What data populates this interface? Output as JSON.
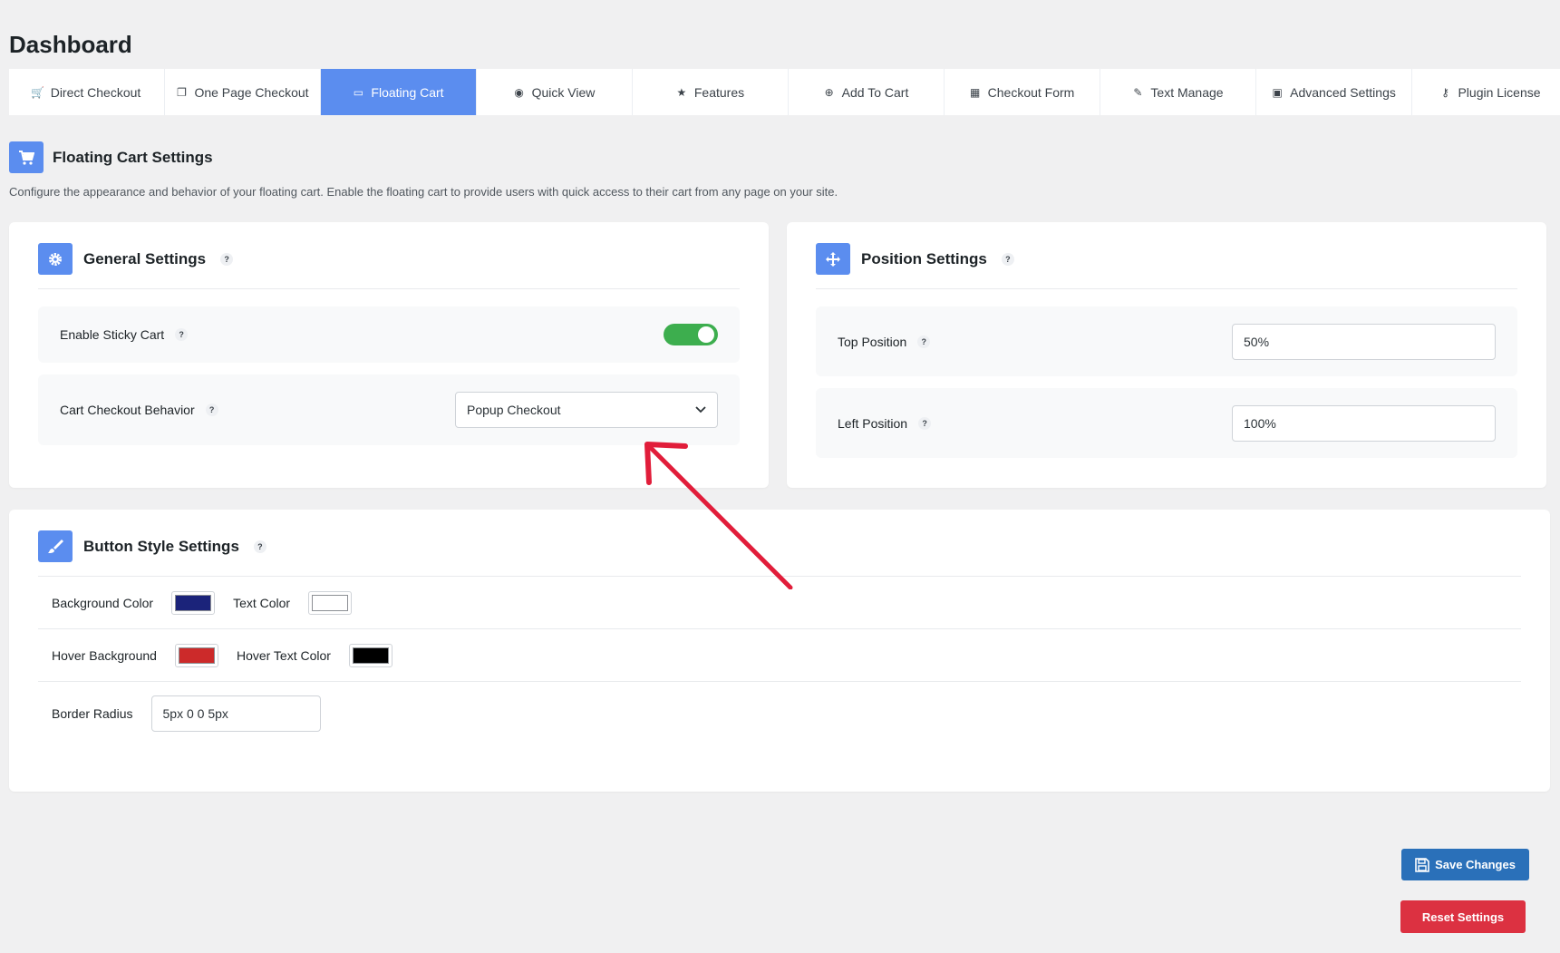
{
  "page_title": "Dashboard",
  "tabs": [
    {
      "label": "Direct Checkout",
      "icon": "cart-icon",
      "glyph": "🛒"
    },
    {
      "label": "One Page Checkout",
      "icon": "copy-icon",
      "glyph": "❐"
    },
    {
      "label": "Floating Cart",
      "icon": "window-icon",
      "glyph": "▭",
      "active": true
    },
    {
      "label": "Quick View",
      "icon": "eye-icon",
      "glyph": "◉"
    },
    {
      "label": "Features",
      "icon": "star-icon",
      "glyph": "★"
    },
    {
      "label": "Add To Cart",
      "icon": "plus-circle-icon",
      "glyph": "⊕"
    },
    {
      "label": "Checkout Form",
      "icon": "form-icon",
      "glyph": "▦"
    },
    {
      "label": "Text Manage",
      "icon": "pencil-icon",
      "glyph": "✎"
    },
    {
      "label": "Advanced Settings",
      "icon": "grid-icon",
      "glyph": "▣"
    },
    {
      "label": "Plugin License",
      "icon": "key-icon",
      "glyph": "⚷"
    }
  ],
  "section": {
    "title": "Floating Cart Settings",
    "description": "Configure the appearance and behavior of your floating cart. Enable the floating cart to provide users with quick access to their cart from any page on your site."
  },
  "general": {
    "title": "General Settings",
    "help": "?",
    "sticky_label": "Enable Sticky Cart",
    "sticky_enabled": true,
    "behavior_label": "Cart Checkout Behavior",
    "behavior_value": "Popup Checkout"
  },
  "position": {
    "title": "Position Settings",
    "help": "?",
    "top_label": "Top Position",
    "top_value": "50%",
    "left_label": "Left Position",
    "left_value": "100%"
  },
  "button_style": {
    "title": "Button Style Settings",
    "help": "?",
    "bg_label": "Background Color",
    "bg_color": "#1b237a",
    "text_label": "Text Color",
    "text_color": "#ffffff",
    "hover_bg_label": "Hover Background",
    "hover_bg_color": "#cc2a2a",
    "hover_text_label": "Hover Text Color",
    "hover_text_color": "#000000",
    "radius_label": "Border Radius",
    "radius_value": "5px 0 0 5px"
  },
  "actions": {
    "save_label": "Save Changes",
    "reset_label": "Reset Settings"
  },
  "colors": {
    "accent": "#5b8def",
    "toggle_on": "#3dae4e",
    "save": "#2a70b9",
    "reset": "#dc3141",
    "annotation_arrow": "#e11d3a"
  }
}
